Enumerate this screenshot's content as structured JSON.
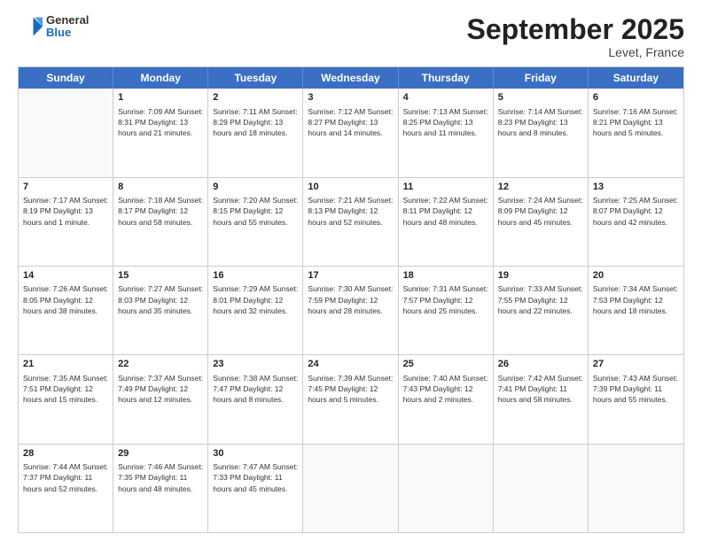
{
  "logo": {
    "general": "General",
    "blue": "Blue"
  },
  "title": "September 2025",
  "subtitle": "Levet, France",
  "days": [
    "Sunday",
    "Monday",
    "Tuesday",
    "Wednesday",
    "Thursday",
    "Friday",
    "Saturday"
  ],
  "rows": [
    [
      {
        "day": "",
        "text": ""
      },
      {
        "day": "1",
        "text": "Sunrise: 7:09 AM\nSunset: 8:31 PM\nDaylight: 13 hours\nand 21 minutes."
      },
      {
        "day": "2",
        "text": "Sunrise: 7:11 AM\nSunset: 8:29 PM\nDaylight: 13 hours\nand 18 minutes."
      },
      {
        "day": "3",
        "text": "Sunrise: 7:12 AM\nSunset: 8:27 PM\nDaylight: 13 hours\nand 14 minutes."
      },
      {
        "day": "4",
        "text": "Sunrise: 7:13 AM\nSunset: 8:25 PM\nDaylight: 13 hours\nand 11 minutes."
      },
      {
        "day": "5",
        "text": "Sunrise: 7:14 AM\nSunset: 8:23 PM\nDaylight: 13 hours\nand 8 minutes."
      },
      {
        "day": "6",
        "text": "Sunrise: 7:16 AM\nSunset: 8:21 PM\nDaylight: 13 hours\nand 5 minutes."
      }
    ],
    [
      {
        "day": "7",
        "text": "Sunrise: 7:17 AM\nSunset: 8:19 PM\nDaylight: 13 hours\nand 1 minute."
      },
      {
        "day": "8",
        "text": "Sunrise: 7:18 AM\nSunset: 8:17 PM\nDaylight: 12 hours\nand 58 minutes."
      },
      {
        "day": "9",
        "text": "Sunrise: 7:20 AM\nSunset: 8:15 PM\nDaylight: 12 hours\nand 55 minutes."
      },
      {
        "day": "10",
        "text": "Sunrise: 7:21 AM\nSunset: 8:13 PM\nDaylight: 12 hours\nand 52 minutes."
      },
      {
        "day": "11",
        "text": "Sunrise: 7:22 AM\nSunset: 8:11 PM\nDaylight: 12 hours\nand 48 minutes."
      },
      {
        "day": "12",
        "text": "Sunrise: 7:24 AM\nSunset: 8:09 PM\nDaylight: 12 hours\nand 45 minutes."
      },
      {
        "day": "13",
        "text": "Sunrise: 7:25 AM\nSunset: 8:07 PM\nDaylight: 12 hours\nand 42 minutes."
      }
    ],
    [
      {
        "day": "14",
        "text": "Sunrise: 7:26 AM\nSunset: 8:05 PM\nDaylight: 12 hours\nand 38 minutes."
      },
      {
        "day": "15",
        "text": "Sunrise: 7:27 AM\nSunset: 8:03 PM\nDaylight: 12 hours\nand 35 minutes."
      },
      {
        "day": "16",
        "text": "Sunrise: 7:29 AM\nSunset: 8:01 PM\nDaylight: 12 hours\nand 32 minutes."
      },
      {
        "day": "17",
        "text": "Sunrise: 7:30 AM\nSunset: 7:59 PM\nDaylight: 12 hours\nand 28 minutes."
      },
      {
        "day": "18",
        "text": "Sunrise: 7:31 AM\nSunset: 7:57 PM\nDaylight: 12 hours\nand 25 minutes."
      },
      {
        "day": "19",
        "text": "Sunrise: 7:33 AM\nSunset: 7:55 PM\nDaylight: 12 hours\nand 22 minutes."
      },
      {
        "day": "20",
        "text": "Sunrise: 7:34 AM\nSunset: 7:53 PM\nDaylight: 12 hours\nand 18 minutes."
      }
    ],
    [
      {
        "day": "21",
        "text": "Sunrise: 7:35 AM\nSunset: 7:51 PM\nDaylight: 12 hours\nand 15 minutes."
      },
      {
        "day": "22",
        "text": "Sunrise: 7:37 AM\nSunset: 7:49 PM\nDaylight: 12 hours\nand 12 minutes."
      },
      {
        "day": "23",
        "text": "Sunrise: 7:38 AM\nSunset: 7:47 PM\nDaylight: 12 hours\nand 8 minutes."
      },
      {
        "day": "24",
        "text": "Sunrise: 7:39 AM\nSunset: 7:45 PM\nDaylight: 12 hours\nand 5 minutes."
      },
      {
        "day": "25",
        "text": "Sunrise: 7:40 AM\nSunset: 7:43 PM\nDaylight: 12 hours\nand 2 minutes."
      },
      {
        "day": "26",
        "text": "Sunrise: 7:42 AM\nSunset: 7:41 PM\nDaylight: 11 hours\nand 58 minutes."
      },
      {
        "day": "27",
        "text": "Sunrise: 7:43 AM\nSunset: 7:39 PM\nDaylight: 11 hours\nand 55 minutes."
      }
    ],
    [
      {
        "day": "28",
        "text": "Sunrise: 7:44 AM\nSunset: 7:37 PM\nDaylight: 11 hours\nand 52 minutes."
      },
      {
        "day": "29",
        "text": "Sunrise: 7:46 AM\nSunset: 7:35 PM\nDaylight: 11 hours\nand 48 minutes."
      },
      {
        "day": "30",
        "text": "Sunrise: 7:47 AM\nSunset: 7:33 PM\nDaylight: 11 hours\nand 45 minutes."
      },
      {
        "day": "",
        "text": ""
      },
      {
        "day": "",
        "text": ""
      },
      {
        "day": "",
        "text": ""
      },
      {
        "day": "",
        "text": ""
      }
    ]
  ]
}
